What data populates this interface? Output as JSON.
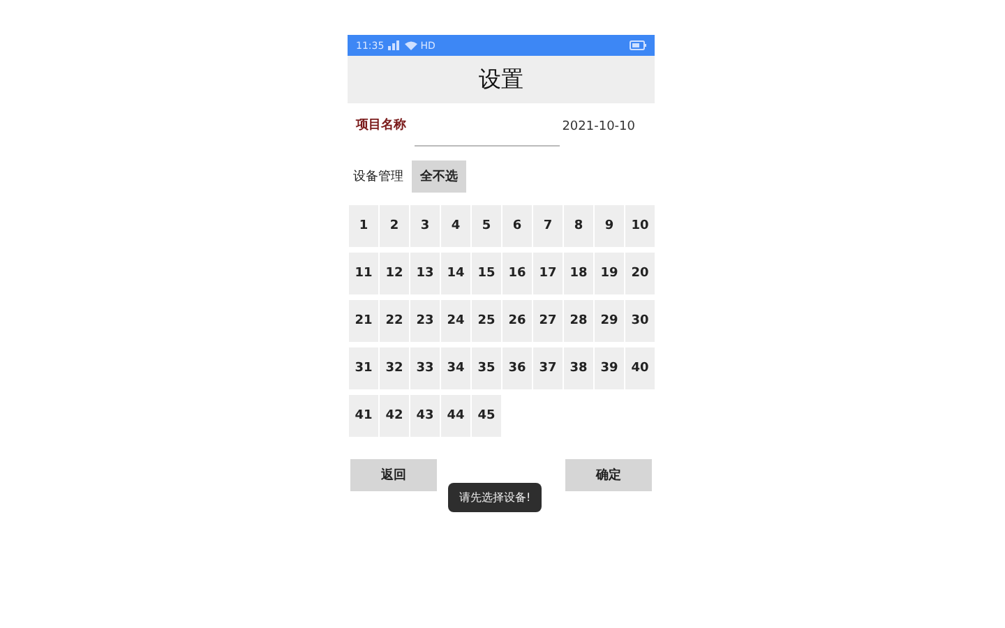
{
  "status_bar": {
    "time": "11:35",
    "network": "HD"
  },
  "title": "设置",
  "project": {
    "label": "项目名称",
    "date": "2021-10-10"
  },
  "device_management": {
    "label": "设备管理",
    "button": "全不选"
  },
  "devices": [
    {
      "label": "1",
      "selected": false
    },
    {
      "label": "2",
      "selected": false
    },
    {
      "label": "3",
      "selected": false
    },
    {
      "label": "4",
      "selected": false
    },
    {
      "label": "5",
      "selected": false
    },
    {
      "label": "6",
      "selected": false
    },
    {
      "label": "7",
      "selected": false
    },
    {
      "label": "8",
      "selected": false
    },
    {
      "label": "9",
      "selected": false
    },
    {
      "label": "10",
      "selected": false
    },
    {
      "label": "11",
      "selected": false
    },
    {
      "label": "12",
      "selected": false
    },
    {
      "label": "13",
      "selected": false
    },
    {
      "label": "14",
      "selected": false
    },
    {
      "label": "15",
      "selected": false
    },
    {
      "label": "16",
      "selected": false
    },
    {
      "label": "17",
      "selected": false
    },
    {
      "label": "18",
      "selected": false
    },
    {
      "label": "19",
      "selected": false
    },
    {
      "label": "20",
      "selected": false
    },
    {
      "label": "21",
      "selected": false
    },
    {
      "label": "22",
      "selected": false
    },
    {
      "label": "23",
      "selected": false
    },
    {
      "label": "24",
      "selected": false
    },
    {
      "label": "25",
      "selected": false
    },
    {
      "label": "26",
      "selected": false
    },
    {
      "label": "27",
      "selected": false
    },
    {
      "label": "28",
      "selected": false
    },
    {
      "label": "29",
      "selected": false
    },
    {
      "label": "30",
      "selected": false
    },
    {
      "label": "31",
      "selected": false
    },
    {
      "label": "32",
      "selected": false
    },
    {
      "label": "33",
      "selected": false
    },
    {
      "label": "34",
      "selected": false
    },
    {
      "label": "35",
      "selected": false
    },
    {
      "label": "36",
      "selected": false
    },
    {
      "label": "37",
      "selected": false
    },
    {
      "label": "38",
      "selected": false
    },
    {
      "label": "39",
      "selected": false
    },
    {
      "label": "40",
      "selected": false
    },
    {
      "label": "41",
      "selected": false
    },
    {
      "label": "42",
      "selected": false
    },
    {
      "label": "43",
      "selected": false
    },
    {
      "label": "44",
      "selected": false
    },
    {
      "label": "45",
      "selected": false
    }
  ],
  "buttons": [
    "返回",
    "确定"
  ],
  "toast": "请先选择设备!"
}
